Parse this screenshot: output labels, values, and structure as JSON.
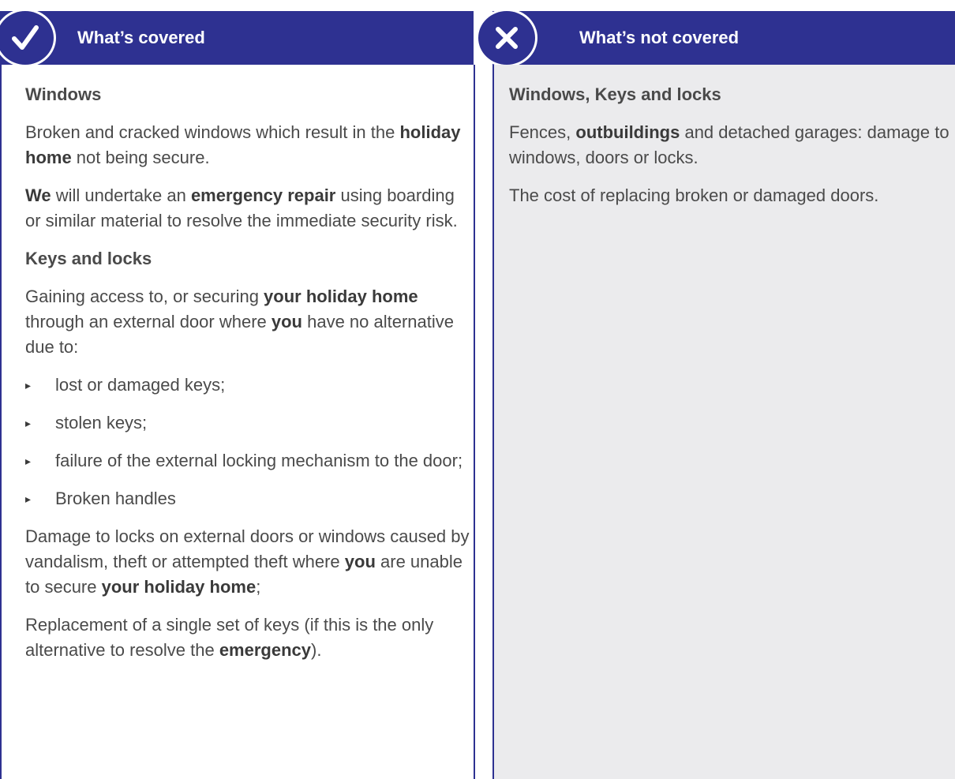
{
  "covered": {
    "header": "What’s covered",
    "windows_heading": "Windows",
    "windows_p1": {
      "t1": "Broken and cracked windows which result in the ",
      "b1": "holiday home",
      "t2": " not being secure."
    },
    "windows_p2": {
      "b1": "We",
      "t1": " will undertake an ",
      "b2": "emergency repair",
      "t2": " using boarding or similar material to resolve the immediate security risk."
    },
    "keys_heading": "Keys and locks",
    "keys_p1": {
      "t1": "Gaining access to, or securing ",
      "b1": "your holiday home",
      "t2": " through an external door where ",
      "b2": "you",
      "t3": " have no alternative due to:"
    },
    "bullet_glyph": "▸",
    "bullets": [
      "lost or damaged keys;",
      "stolen keys;",
      "failure of the external locking mechanism to the door;",
      "Broken handles"
    ],
    "damage_p": {
      "t1": "Damage to locks on external doors or windows caused by vandalism, theft or attempted theft where ",
      "b1": "you",
      "t2": " are unable to secure ",
      "b2": "your holiday home",
      "t3": ";"
    },
    "replace_p": {
      "t1": "Replacement of a single set of keys (if this is the only alternative to resolve the ",
      "b1": "emergency",
      "t2": ")."
    }
  },
  "not_covered": {
    "header": "What’s not covered",
    "heading": "Windows, Keys and locks",
    "p1": {
      "t1": "Fences, ",
      "b1": "outbuildings",
      "t2": " and detached garages: damage to windows, doors or locks."
    },
    "p2": "The cost of replacing broken or damaged doors."
  },
  "icons": {
    "covered": "checkmark-icon",
    "not_covered": "cross-icon"
  },
  "colors": {
    "brand": "#2e3191",
    "panel_grey": "#ebebed",
    "text": "#4a4a4a"
  }
}
